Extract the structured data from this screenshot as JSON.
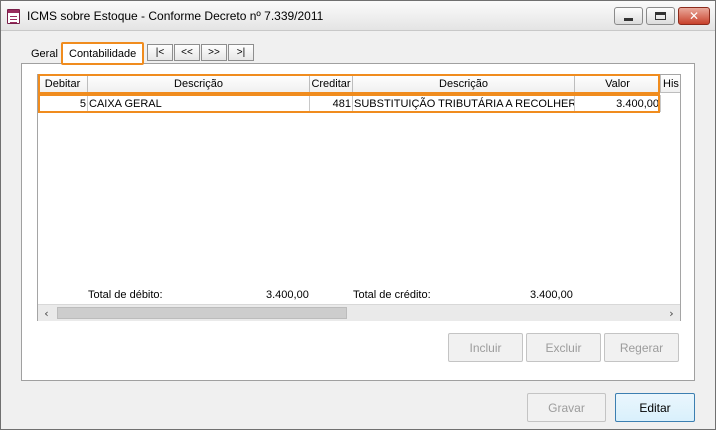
{
  "window": {
    "title": "ICMS sobre Estoque - Conforme Decreto nº 7.339/2011",
    "icon": "document-icon"
  },
  "tabs": [
    {
      "label": "Geral",
      "active": false
    },
    {
      "label": "Contabilidade",
      "active": true
    }
  ],
  "nav_buttons": [
    "|<",
    "<<",
    ">>",
    ">|"
  ],
  "grid": {
    "columns": [
      "Debitar",
      "Descrição",
      "Creditar",
      "Descrição",
      "Valor",
      "His"
    ],
    "rows": [
      {
        "debitar": "5",
        "descricao_debito": "CAIXA GERAL",
        "creditar": "481",
        "descricao_credito": "SUBSTITUIÇÃO TRIBUTÁRIA A RECOLHER",
        "valor": "3.400,00"
      }
    ],
    "total_debito_label": "Total de débito:",
    "total_debito_value": "3.400,00",
    "total_credito_label": "Total de crédito:",
    "total_credito_value": "3.400,00"
  },
  "grid_buttons": {
    "incluir": "Incluir",
    "excluir": "Excluir",
    "regerar": "Regerar"
  },
  "footer_buttons": {
    "gravar": "Gravar",
    "editar": "Editar"
  },
  "colors": {
    "highlight": "#f08c1e",
    "primary_button": "#3c7fb1"
  }
}
